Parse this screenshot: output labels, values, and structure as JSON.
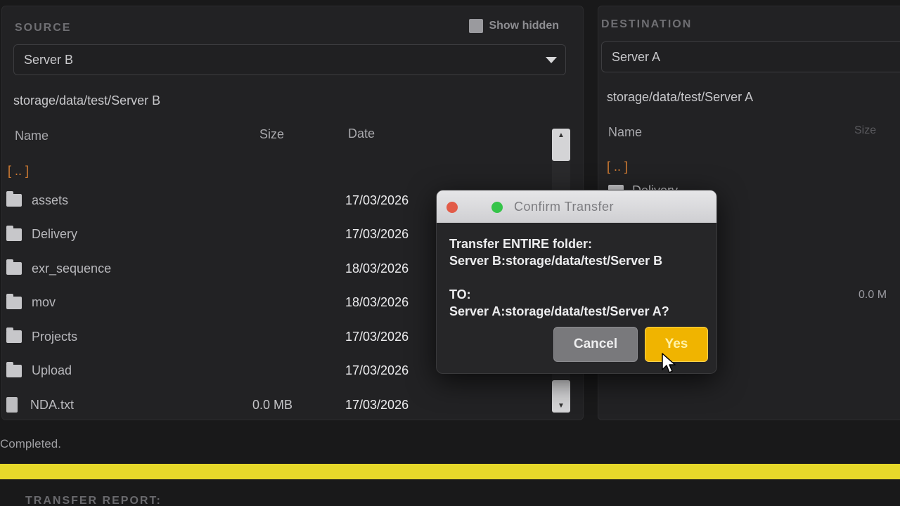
{
  "source": {
    "label": "SOURCE",
    "show_hidden_label": "Show hidden",
    "server": "Server B",
    "path": "storage/data/test/Server B",
    "columns": {
      "name": "Name",
      "size": "Size",
      "date": "Date"
    },
    "parent": "[ .. ]",
    "files": [
      {
        "name": "assets",
        "size": "",
        "date": "17/03/2026",
        "type": "folder"
      },
      {
        "name": "Delivery",
        "size": "",
        "date": "17/03/2026",
        "type": "folder"
      },
      {
        "name": "exr_sequence",
        "size": "",
        "date": "18/03/2026",
        "type": "folder"
      },
      {
        "name": "mov",
        "size": "",
        "date": "18/03/2026",
        "type": "folder"
      },
      {
        "name": "Projects",
        "size": "",
        "date": "17/03/2026",
        "type": "folder"
      },
      {
        "name": "Upload",
        "size": "",
        "date": "17/03/2026",
        "type": "folder"
      },
      {
        "name": "NDA.txt",
        "size": "0.0 MB",
        "date": "17/03/2026",
        "type": "file"
      }
    ]
  },
  "destination": {
    "label": "DESTINATION",
    "server": "Server A",
    "path": "storage/data/test/Server A",
    "columns": {
      "name": "Name",
      "size": "Size"
    },
    "parent": "[ .. ]",
    "first_item": "Delivery",
    "partial_size": "0.0 M"
  },
  "status": {
    "text": "Completed.",
    "progress": 1.0
  },
  "report_label": "TRANSFER REPORT:",
  "modal": {
    "title": "Confirm Transfer",
    "line1": "Transfer ENTIRE folder:",
    "line2": "Server B:storage/data/test/Server B",
    "line3": "TO:",
    "line4": "Server A:storage/data/test/Server A?",
    "cancel_label": "Cancel",
    "yes_label": "Yes"
  },
  "colors": {
    "accent": "#f0b400",
    "progress": "#e7d92a",
    "parent_link": "#d27c33"
  }
}
